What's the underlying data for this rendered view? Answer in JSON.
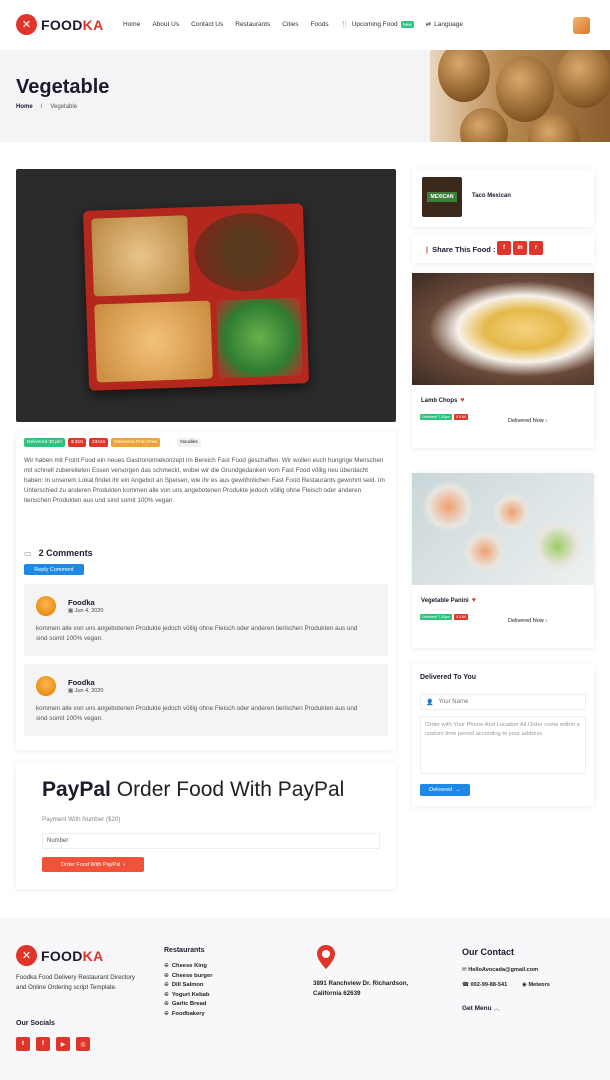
{
  "brand": {
    "name_part1": "FOOD",
    "name_part2": "KA"
  },
  "nav": [
    "Home",
    "About Us",
    "Contact Us",
    "Restaurants",
    "Cities",
    "Foods"
  ],
  "nav_upcoming": "Upcoming Food",
  "nav_badge": "New",
  "nav_language": "Language",
  "banner": {
    "title": "Vegetable",
    "crumb_home": "Home",
    "crumb_sep": "/",
    "crumb_current": "Vegetable"
  },
  "tags": {
    "delivered": "Delivered 30 pm",
    "price": "$ $15",
    "count": "23445",
    "prime": "Delivered Prim-Free",
    "category": "Noodles"
  },
  "description": "Wir haben mit Front Food ein neues Gastronomiekonzept im Bereich Fast Food geschaffen. Wir wollen euch hungrige Menschen mit schnell zubereiteten Essen versorgen das schmeckt, wobei wir die Grundgedanken vom Fast Food völlig neu überdacht haben: In unserem Lokal findet ihr ein Angebot an Speisen, wie ihr es aus gewöhnlichen Fast Food Restaurants gewohnt seid. Im Unterschied zu anderen Produkten kommen alle von uns angebotenen Produkte jedoch völlig ohne Fleisch oder anderen tierischen Produkten aus und sind somit 100% vegan.",
  "comments": {
    "heading": "2 Comments",
    "reply_label": "Reply Comment",
    "items": [
      {
        "name": "Foodka",
        "date": "Jun 4, 2020",
        "text": "kommen alle von uns angebotenen Produkte jedoch völlig ohne Fleisch oder anderen tierischen Produkten aus und sind somit 100% vegan."
      },
      {
        "name": "Foodka",
        "date": "Jun 4, 2020",
        "text": "kommen alle von uns angebotenen Produkte jedoch völlig ohne Fleisch oder anderen tierischen Produkten aus und sind somit 100% vegan."
      }
    ]
  },
  "paypal": {
    "title_bold": "PayPal",
    "title_rest": "Order Food With PayPal",
    "label": "Payment With Number ($20)",
    "placeholder": "Number",
    "button": "Order Food With PayPal"
  },
  "sidebar": {
    "restaurant": {
      "logo_text": "MEXICAN",
      "name": "Taco Mexican"
    },
    "share_label": "Share This Food :",
    "share_buttons": [
      "f",
      "in",
      "r"
    ],
    "foods": [
      {
        "name": "Lamb Chops",
        "tag1": "Delivered 7.30pm",
        "tag2": "$ 5.60",
        "cta": "Delivered Now"
      },
      {
        "name": "Vegetable Panini",
        "tag1": "Delivered 7.30pm",
        "tag2": "$ 3.60",
        "cta": "Delivered Now"
      }
    ],
    "delivered": {
      "title": "Delivered To You",
      "name_placeholder": "Your Name",
      "message_placeholder": "Order with Your Phone And Location All Order come within a custom time period according to your address",
      "button": "Delivered"
    }
  },
  "footer": {
    "brand_part1": "FOOD",
    "brand_part2": "KA",
    "description": "Foodka Food Delivery Restaurant Directory and Online Ordering script Template.",
    "socials_title": "Our Socials",
    "socials": [
      "t",
      "f",
      "▶",
      "◎"
    ],
    "restaurants_title": "Restaurants",
    "restaurants": [
      "Cheese King",
      "Cheese burger",
      "Dill Salmon",
      "Yogurt Kebab",
      "Garlic Bread",
      "Foodbakery"
    ],
    "address": "3891 Ranchview Dr. Richardson, California 62639",
    "contact_title": "Our Contact",
    "email": "HelloAvocada@gmail.com",
    "phone": "002-99-88-541",
    "meteors": "Meteors",
    "menu": "Get Menu"
  },
  "colors": {
    "brand_red": "#e0352b",
    "accent_blue": "#1e88e5",
    "tag_green": "#2ec27e",
    "tag_orange": "#f0a23a",
    "paypal_btn": "#f0533a"
  }
}
